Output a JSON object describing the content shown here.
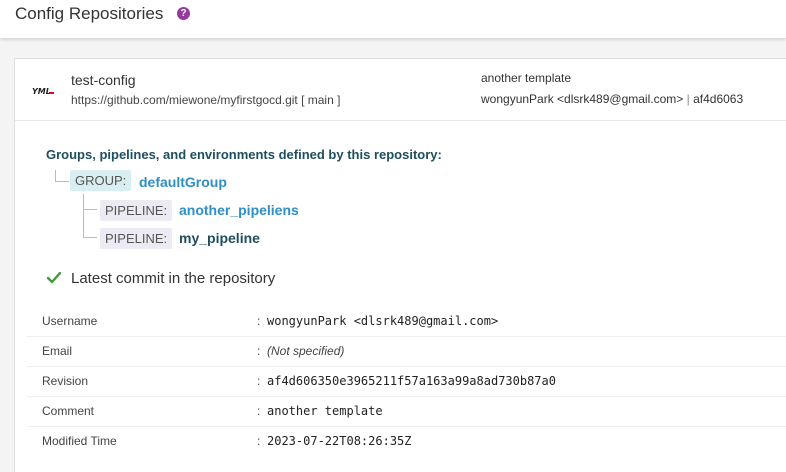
{
  "page": {
    "title": "Config Repositories",
    "help_icon": "?"
  },
  "repo": {
    "logo_text": "YML",
    "name": "test-config",
    "url": "https://github.com/miewone/myfirstgocd.git [ main ]",
    "last_commit_message": "another template",
    "last_commit_author": "wongyunPark <dlsrk489@gmail.com>",
    "separator": "|",
    "last_commit_short": "af4d6063"
  },
  "definitions": {
    "heading": "Groups, pipelines, and environments defined by this repository:",
    "group": {
      "tag": "GROUP:",
      "name": "defaultGroup"
    },
    "pipelines": [
      {
        "tag": "PIPELINE:",
        "name": "another_pipeliens"
      },
      {
        "tag": "PIPELINE:",
        "name": "my_pipeline"
      }
    ]
  },
  "latest_commit": {
    "heading": "Latest commit in the repository",
    "status_color": "#3f9c35",
    "rows": [
      {
        "label": "Username",
        "value": "wongyunPark <dlsrk489@gmail.com>"
      },
      {
        "label": "Email",
        "value": "(Not specified)"
      },
      {
        "label": "Revision",
        "value": "af4d606350e3965211f57a163a99a8ad730b87a0"
      },
      {
        "label": "Comment",
        "value": "another template"
      },
      {
        "label": "Modified Time",
        "value": "2023-07-22T08:26:35Z"
      }
    ],
    "colon": ":"
  }
}
